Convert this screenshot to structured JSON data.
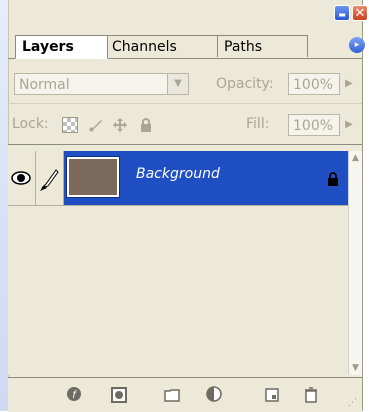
{
  "window": {
    "minimize_glyph": "▬",
    "close_glyph": "✕"
  },
  "tabs": [
    {
      "label": "Layers",
      "active": true
    },
    {
      "label": "Channels",
      "active": false
    },
    {
      "label": "Paths",
      "active": false
    }
  ],
  "panel_menu_glyph": "▸",
  "blend": {
    "mode": "Normal",
    "opacity_label": "Opacity:",
    "opacity_value": "100%"
  },
  "lock": {
    "label": "Lock:",
    "fill_label": "Fill:",
    "fill_value": "100%"
  },
  "layers": [
    {
      "name": "Background",
      "visible": true,
      "selected": true,
      "locked": true,
      "thumbnail_color": "#7b6a5b"
    }
  ],
  "colors": {
    "panel": "#ece9d8",
    "selection": "#1f4fc3"
  },
  "icons": [
    "eye-icon",
    "brush-icon",
    "lock-icon",
    "layer-style-icon",
    "mask-icon",
    "folder-icon",
    "adjustment-icon",
    "new-layer-icon",
    "trash-icon"
  ]
}
